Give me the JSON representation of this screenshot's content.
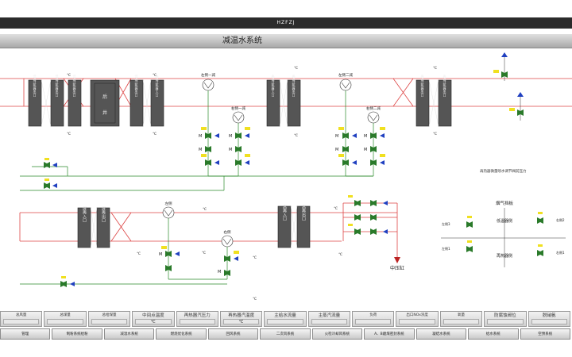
{
  "header": {
    "app_title": "HZFZJ"
  },
  "page": {
    "title": "减温水系统"
  },
  "temp_unit": "℃",
  "upper_boxes": [
    {
      "id": "u1",
      "text": "低温过热器出口"
    },
    {
      "id": "u2",
      "text": "低温过热器出口"
    },
    {
      "id": "u3",
      "text": "低温过热器出口"
    },
    {
      "id": "u4",
      "text": "汽水分离器出口"
    },
    {
      "id": "u5",
      "text": "低温过热器出口"
    },
    {
      "id": "u6",
      "text": "高温过热器入口"
    },
    {
      "id": "u7",
      "text": "高温过热器入口"
    },
    {
      "id": "u8",
      "text": "高温过热器出口"
    },
    {
      "id": "u9",
      "text": "高温过热器出口"
    }
  ],
  "separator": {
    "text": "汽水分离器出口",
    "char1": "后",
    "char2": "井"
  },
  "lower_boxes": [
    {
      "id": "l1",
      "text": "屏再入口"
    },
    {
      "id": "l2",
      "text": "屏再出口"
    },
    {
      "id": "l3",
      "text": "高再入口"
    },
    {
      "id": "l4",
      "text": "高再出口"
    }
  ],
  "spray_labels": {
    "left1": "左侧一减",
    "right1": "右侧一减",
    "left2": "左侧二减",
    "right2": "右侧二减",
    "left_re": "左侧",
    "right_re": "右侧"
  },
  "outlet_label": "中压缸",
  "right_panel": {
    "note": "再热器微量喷水调节阀前压力",
    "header": "烟气挡板",
    "sub1": "低温器侧",
    "sub2": "再热器侧",
    "left_top": "左侧3",
    "right_top": "右侧2",
    "left_bot": "左侧1",
    "right_bot": "右侧1"
  },
  "stats": [
    {
      "label": "总风量",
      "value": ""
    },
    {
      "label": "总煤量",
      "value": ""
    },
    {
      "label": "总给煤量",
      "value": ""
    },
    {
      "label": "中间点温度",
      "value": "℃"
    },
    {
      "label": "再热器汽压力",
      "value": ""
    },
    {
      "label": "再热器汽温度",
      "value": "℃"
    },
    {
      "label": "主给水流量",
      "value": ""
    },
    {
      "label": "主蒸汽流量",
      "value": ""
    },
    {
      "label": "负荷",
      "value": ""
    },
    {
      "label": "出口NOx浓度",
      "value": ""
    },
    {
      "label": "氧量",
      "value": ""
    },
    {
      "label": "防腐蚀阀位",
      "value": ""
    },
    {
      "label": "脱硝氨",
      "value": ""
    }
  ],
  "nav": [
    "管理",
    "制粉系统给粉",
    "减温水系统",
    "燃烧优化系统",
    "回风系统",
    "二次风系统",
    "火检冷却风系统",
    "A、B磨煤密封系统",
    "凝结水系统",
    "给水系统",
    "空预系统"
  ]
}
